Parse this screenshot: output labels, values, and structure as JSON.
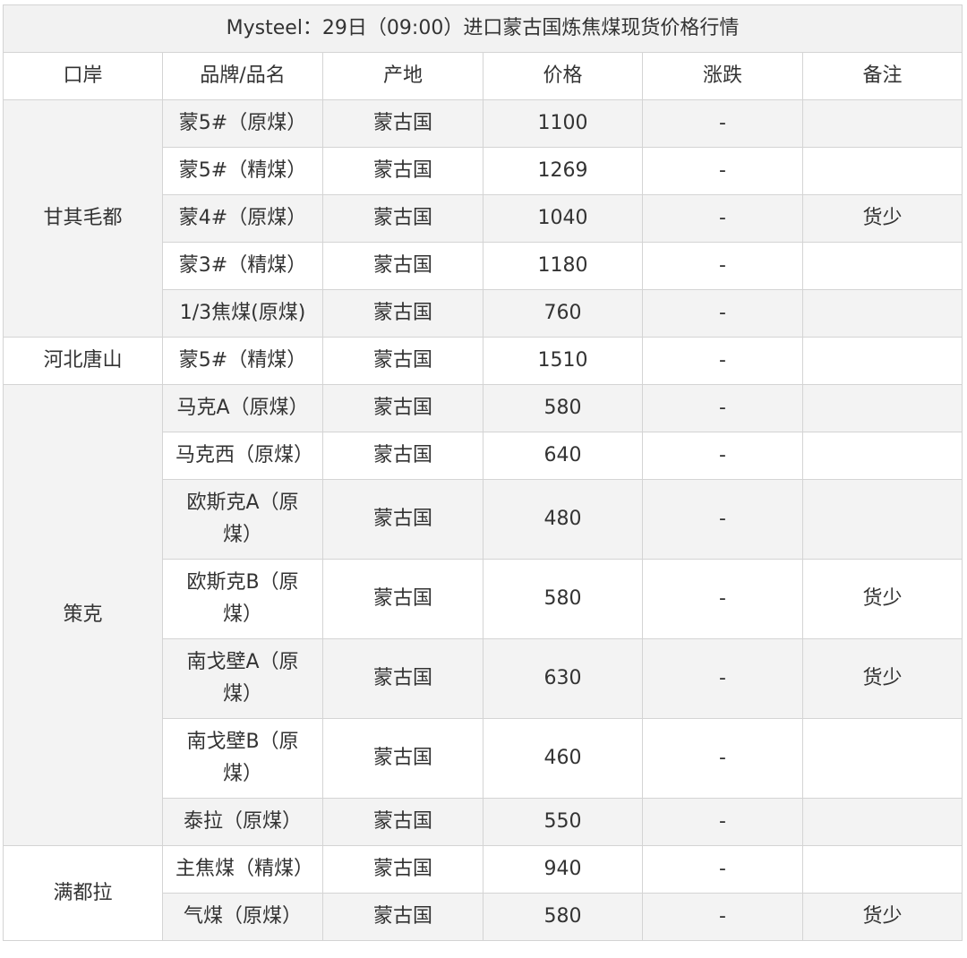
{
  "title": "Mysteel：29日（09:00）进口蒙古国炼焦煤现货价格行情",
  "headers": [
    "口岸",
    "品牌/品名",
    "产地",
    "价格",
    "涨跌",
    "备注"
  ],
  "ports": [
    "甘其毛都",
    "河北唐山",
    "策克",
    "满都拉"
  ],
  "rows": [
    {
      "brand": "蒙5#（原煤）",
      "origin": "蒙古国",
      "price": "1100",
      "change": "-",
      "note": ""
    },
    {
      "brand": "蒙5#（精煤）",
      "origin": "蒙古国",
      "price": "1269",
      "change": "-",
      "note": ""
    },
    {
      "brand": "蒙4#（原煤）",
      "origin": "蒙古国",
      "price": "1040",
      "change": "-",
      "note": "货少"
    },
    {
      "brand": "蒙3#（精煤）",
      "origin": "蒙古国",
      "price": "1180",
      "change": "-",
      "note": ""
    },
    {
      "brand": "1/3焦煤(原煤)",
      "origin": "蒙古国",
      "price": "760",
      "change": "-",
      "note": ""
    },
    {
      "brand": "蒙5#（精煤）",
      "origin": "蒙古国",
      "price": "1510",
      "change": "-",
      "note": ""
    },
    {
      "brand": "马克A（原煤）",
      "origin": "蒙古国",
      "price": "580",
      "change": "-",
      "note": ""
    },
    {
      "brand": "马克西（原煤）",
      "origin": "蒙古国",
      "price": "640",
      "change": "-",
      "note": ""
    },
    {
      "brand": "欧斯克A（原煤）",
      "origin": "蒙古国",
      "price": "480",
      "change": "-",
      "note": ""
    },
    {
      "brand": "欧斯克B（原煤）",
      "origin": "蒙古国",
      "price": "580",
      "change": "-",
      "note": "货少"
    },
    {
      "brand": "南戈壁A（原煤）",
      "origin": "蒙古国",
      "price": "630",
      "change": "-",
      "note": "货少"
    },
    {
      "brand": "南戈壁B（原煤）",
      "origin": "蒙古国",
      "price": "460",
      "change": "-",
      "note": ""
    },
    {
      "brand": "泰拉（原煤）",
      "origin": "蒙古国",
      "price": "550",
      "change": "-",
      "note": ""
    },
    {
      "brand": "主焦煤（精煤）",
      "origin": "蒙古国",
      "price": "940",
      "change": "-",
      "note": ""
    },
    {
      "brand": "气煤（原煤）",
      "origin": "蒙古国",
      "price": "580",
      "change": "-",
      "note": "货少"
    }
  ]
}
